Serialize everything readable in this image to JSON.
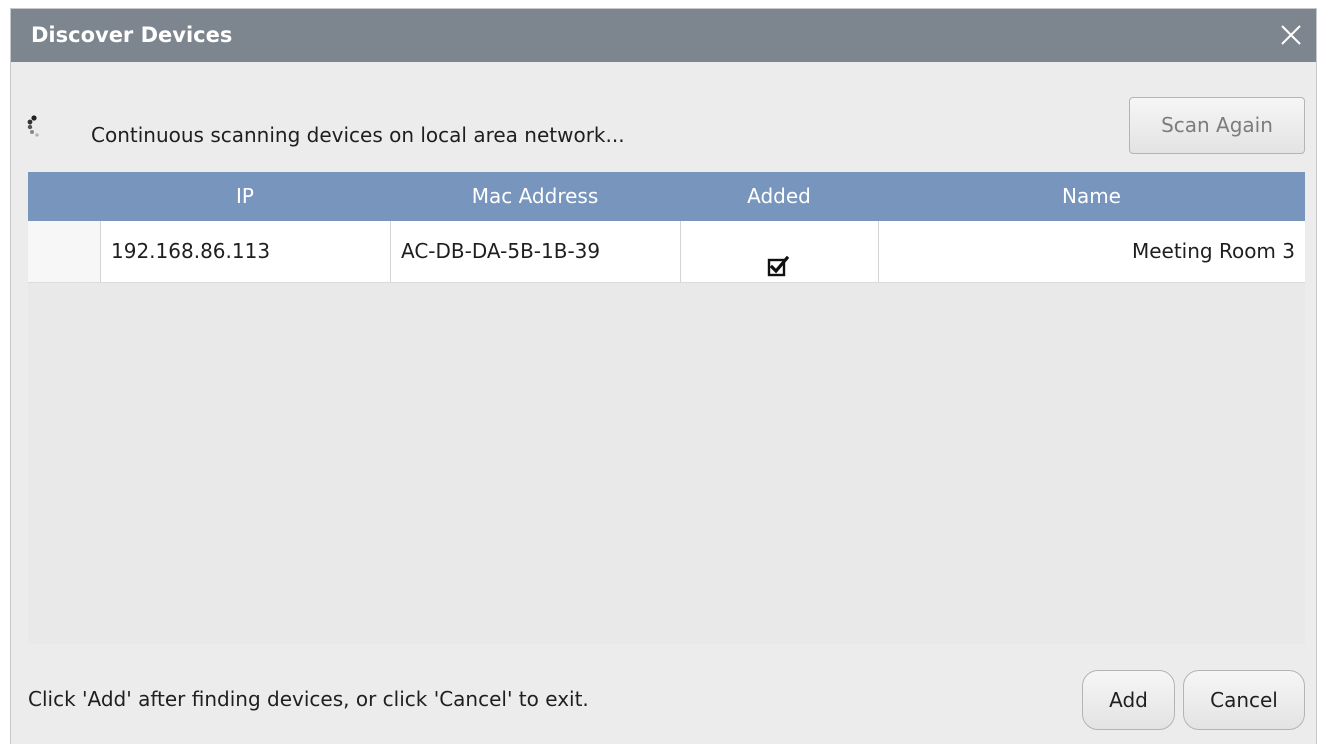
{
  "window": {
    "title": "Discover Devices",
    "close_icon": "close-icon"
  },
  "status": {
    "spinner_icon": "loading-spinner-icon",
    "text": "Continuous scanning devices on local area network..."
  },
  "scan_button": {
    "label": "Scan Again",
    "enabled": false
  },
  "table": {
    "columns": [
      "IP",
      "Mac Address",
      "Added",
      "Name"
    ],
    "rows": [
      {
        "ip": "192.168.86.113",
        "mac": "AC-DB-DA-5B-1B-39",
        "added": true,
        "name": "Meeting Room 3"
      }
    ]
  },
  "footer": {
    "hint": "Click 'Add' after finding devices, or click 'Cancel' to exit.",
    "add_label": "Add",
    "cancel_label": "Cancel"
  },
  "colors": {
    "titlebar": "#7d858e",
    "table_header": "#7896bd",
    "dialog_background": "#ececec"
  }
}
